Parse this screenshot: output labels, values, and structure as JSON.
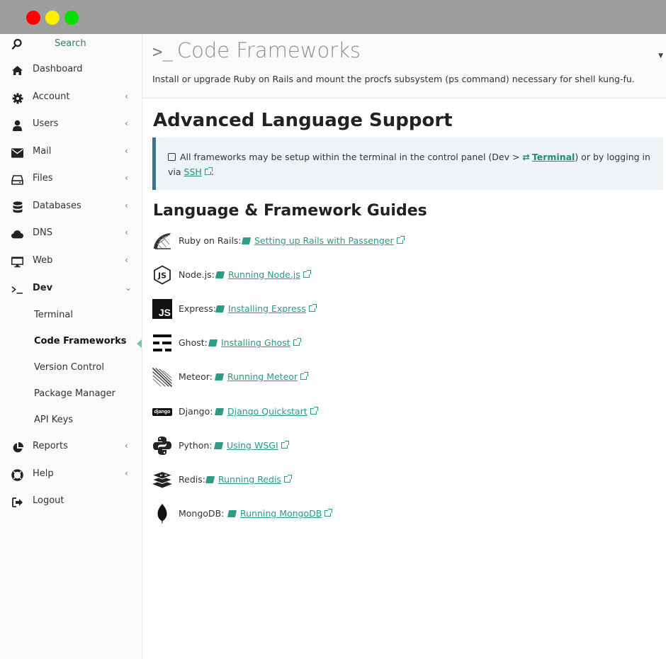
{
  "search": {
    "label": "Search"
  },
  "sidebar": {
    "items": [
      {
        "label": "Dashboard",
        "icon": "home-icon",
        "chevron": ""
      },
      {
        "label": "Account",
        "icon": "gear-icon",
        "chevron": "‹"
      },
      {
        "label": "Users",
        "icon": "user-icon",
        "chevron": "‹"
      },
      {
        "label": "Mail",
        "icon": "envelope-icon",
        "chevron": "‹"
      },
      {
        "label": "Files",
        "icon": "drive-icon",
        "chevron": "‹"
      },
      {
        "label": "Databases",
        "icon": "database-icon",
        "chevron": "‹"
      },
      {
        "label": "DNS",
        "icon": "cloud-icon",
        "chevron": "‹"
      },
      {
        "label": "Web",
        "icon": "monitor-icon",
        "chevron": "‹"
      },
      {
        "label": "Dev",
        "icon": "terminal-icon",
        "chevron": "⌄"
      },
      {
        "label": "Reports",
        "icon": "pie-chart-icon",
        "chevron": "‹"
      },
      {
        "label": "Help",
        "icon": "life-ring-icon",
        "chevron": "‹"
      },
      {
        "label": "Logout",
        "icon": "sign-out-icon",
        "chevron": ""
      }
    ],
    "dev_subitems": [
      {
        "label": "Terminal"
      },
      {
        "label": "Code Frameworks"
      },
      {
        "label": "Version Control"
      },
      {
        "label": "Package Manager"
      },
      {
        "label": "API Keys"
      }
    ]
  },
  "header": {
    "prompt": ">_",
    "title": "Code Frameworks",
    "description": "Install or upgrade Ruby on Rails and mount the procfs subsystem (ps command) necessary for shell kung-fu."
  },
  "main": {
    "heading": "Advanced Language Support",
    "callout": {
      "text_before": "All frameworks may be setup within the terminal in the control panel (Dev > ",
      "terminal_link": "Terminal",
      "text_middle": ") or by logging in via ",
      "ssh_link": "SSH",
      "text_after": "."
    },
    "guides_heading": "Language & Framework Guides",
    "guides": [
      {
        "name": "Ruby on Rails:",
        "link": "Setting up Rails with Passenger",
        "icon": "rails-icon"
      },
      {
        "name": "Node.js:",
        "link": "Running Node.js",
        "icon": "nodejs-icon"
      },
      {
        "name": "Express:",
        "link": "Installing Express",
        "icon": "js-icon",
        "logo_text": "JS"
      },
      {
        "name": "Ghost:",
        "link": "Installing Ghost",
        "icon": "ghost-icon"
      },
      {
        "name": "Meteor:",
        "link": "Running Meteor",
        "icon": "meteor-icon"
      },
      {
        "name": "Django:",
        "link": "Django Quickstart",
        "icon": "django-icon",
        "logo_text": "django"
      },
      {
        "name": "Python:",
        "link": "Using WSGI",
        "icon": "python-icon"
      },
      {
        "name": "Redis:",
        "link": "Running Redis",
        "icon": "redis-icon"
      },
      {
        "name": "MongoDB:",
        "link": "Running MongoDB",
        "icon": "mongodb-icon"
      }
    ]
  }
}
